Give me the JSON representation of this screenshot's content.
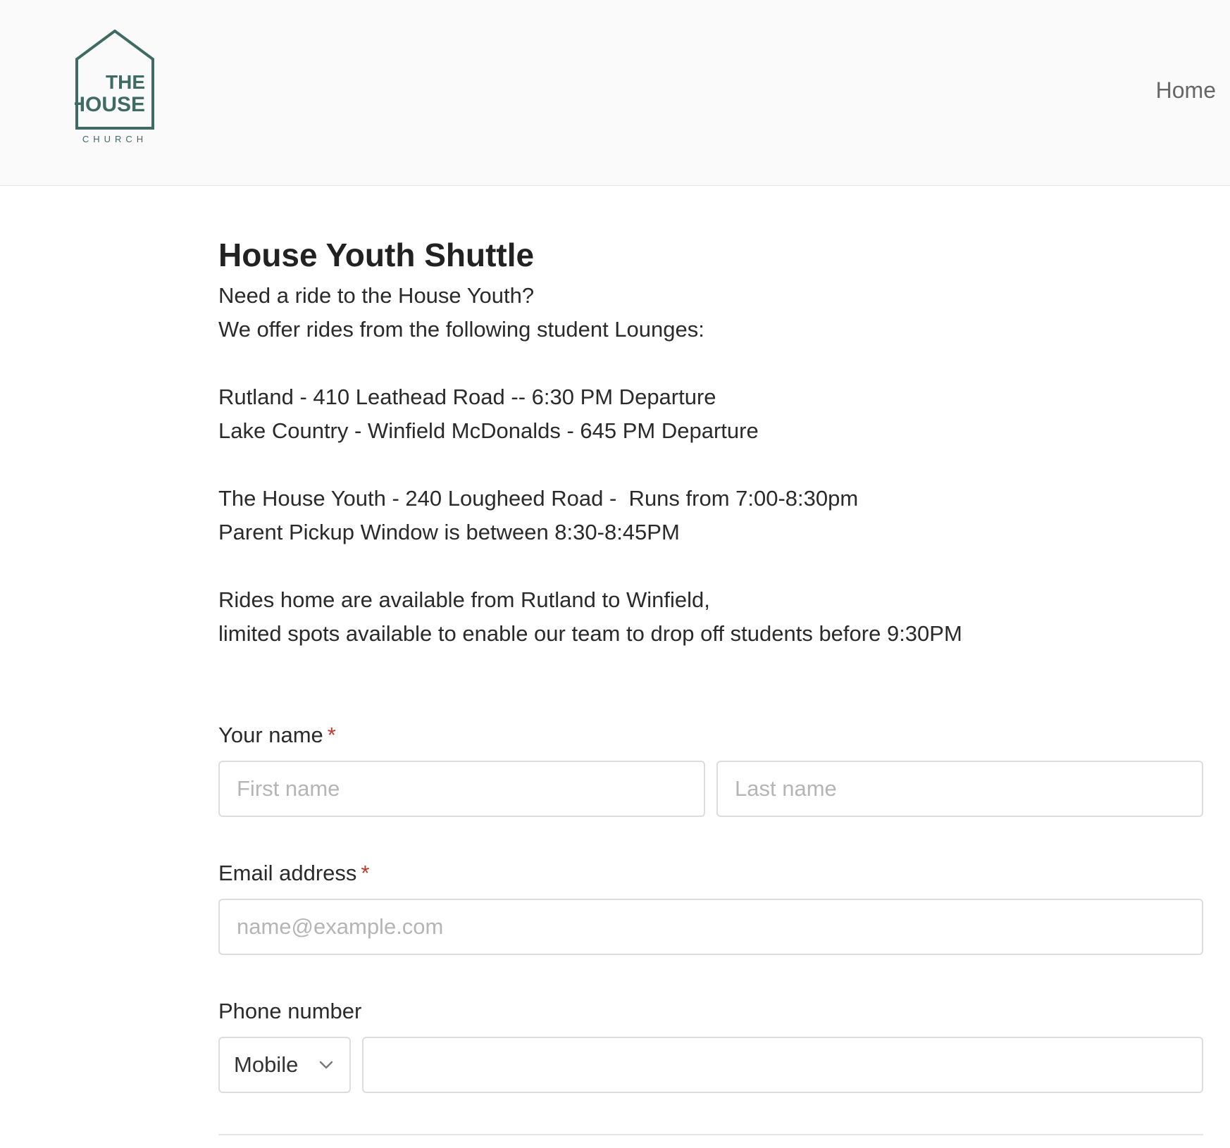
{
  "header": {
    "logo": {
      "line1": "THE",
      "line2": "HOUSE",
      "line3": "CHURCH",
      "color": "#3f6b62"
    },
    "nav": {
      "home_label": "Home"
    }
  },
  "main": {
    "title": "House Youth Shuttle",
    "description_lines": [
      "Need a ride to the House Youth?",
      "We offer rides from the following student Lounges:",
      "",
      "Rutland - 410 Leathead Road -- 6:30 PM Departure",
      "Lake Country - Winfield McDonalds - 645 PM Departure",
      "",
      "The House Youth - 240 Lougheed Road -  Runs from 7:00-8:30pm",
      "Parent Pickup Window is between 8:30-8:45PM",
      "",
      "Rides home are available from Rutland to Winfield,",
      "limited spots available to enable our team to drop off students before 9:30PM"
    ]
  },
  "form": {
    "name": {
      "label": "Your name",
      "required_mark": "*",
      "first_placeholder": "First name",
      "last_placeholder": "Last name"
    },
    "email": {
      "label": "Email address",
      "required_mark": "*",
      "placeholder": "name@example.com"
    },
    "phone": {
      "label": "Phone number",
      "type_selected": "Mobile",
      "value": ""
    }
  },
  "colors": {
    "brand": "#3f6b62",
    "required": "#c0392b",
    "border": "#dcdcdc",
    "header_bg": "#fafafa"
  }
}
